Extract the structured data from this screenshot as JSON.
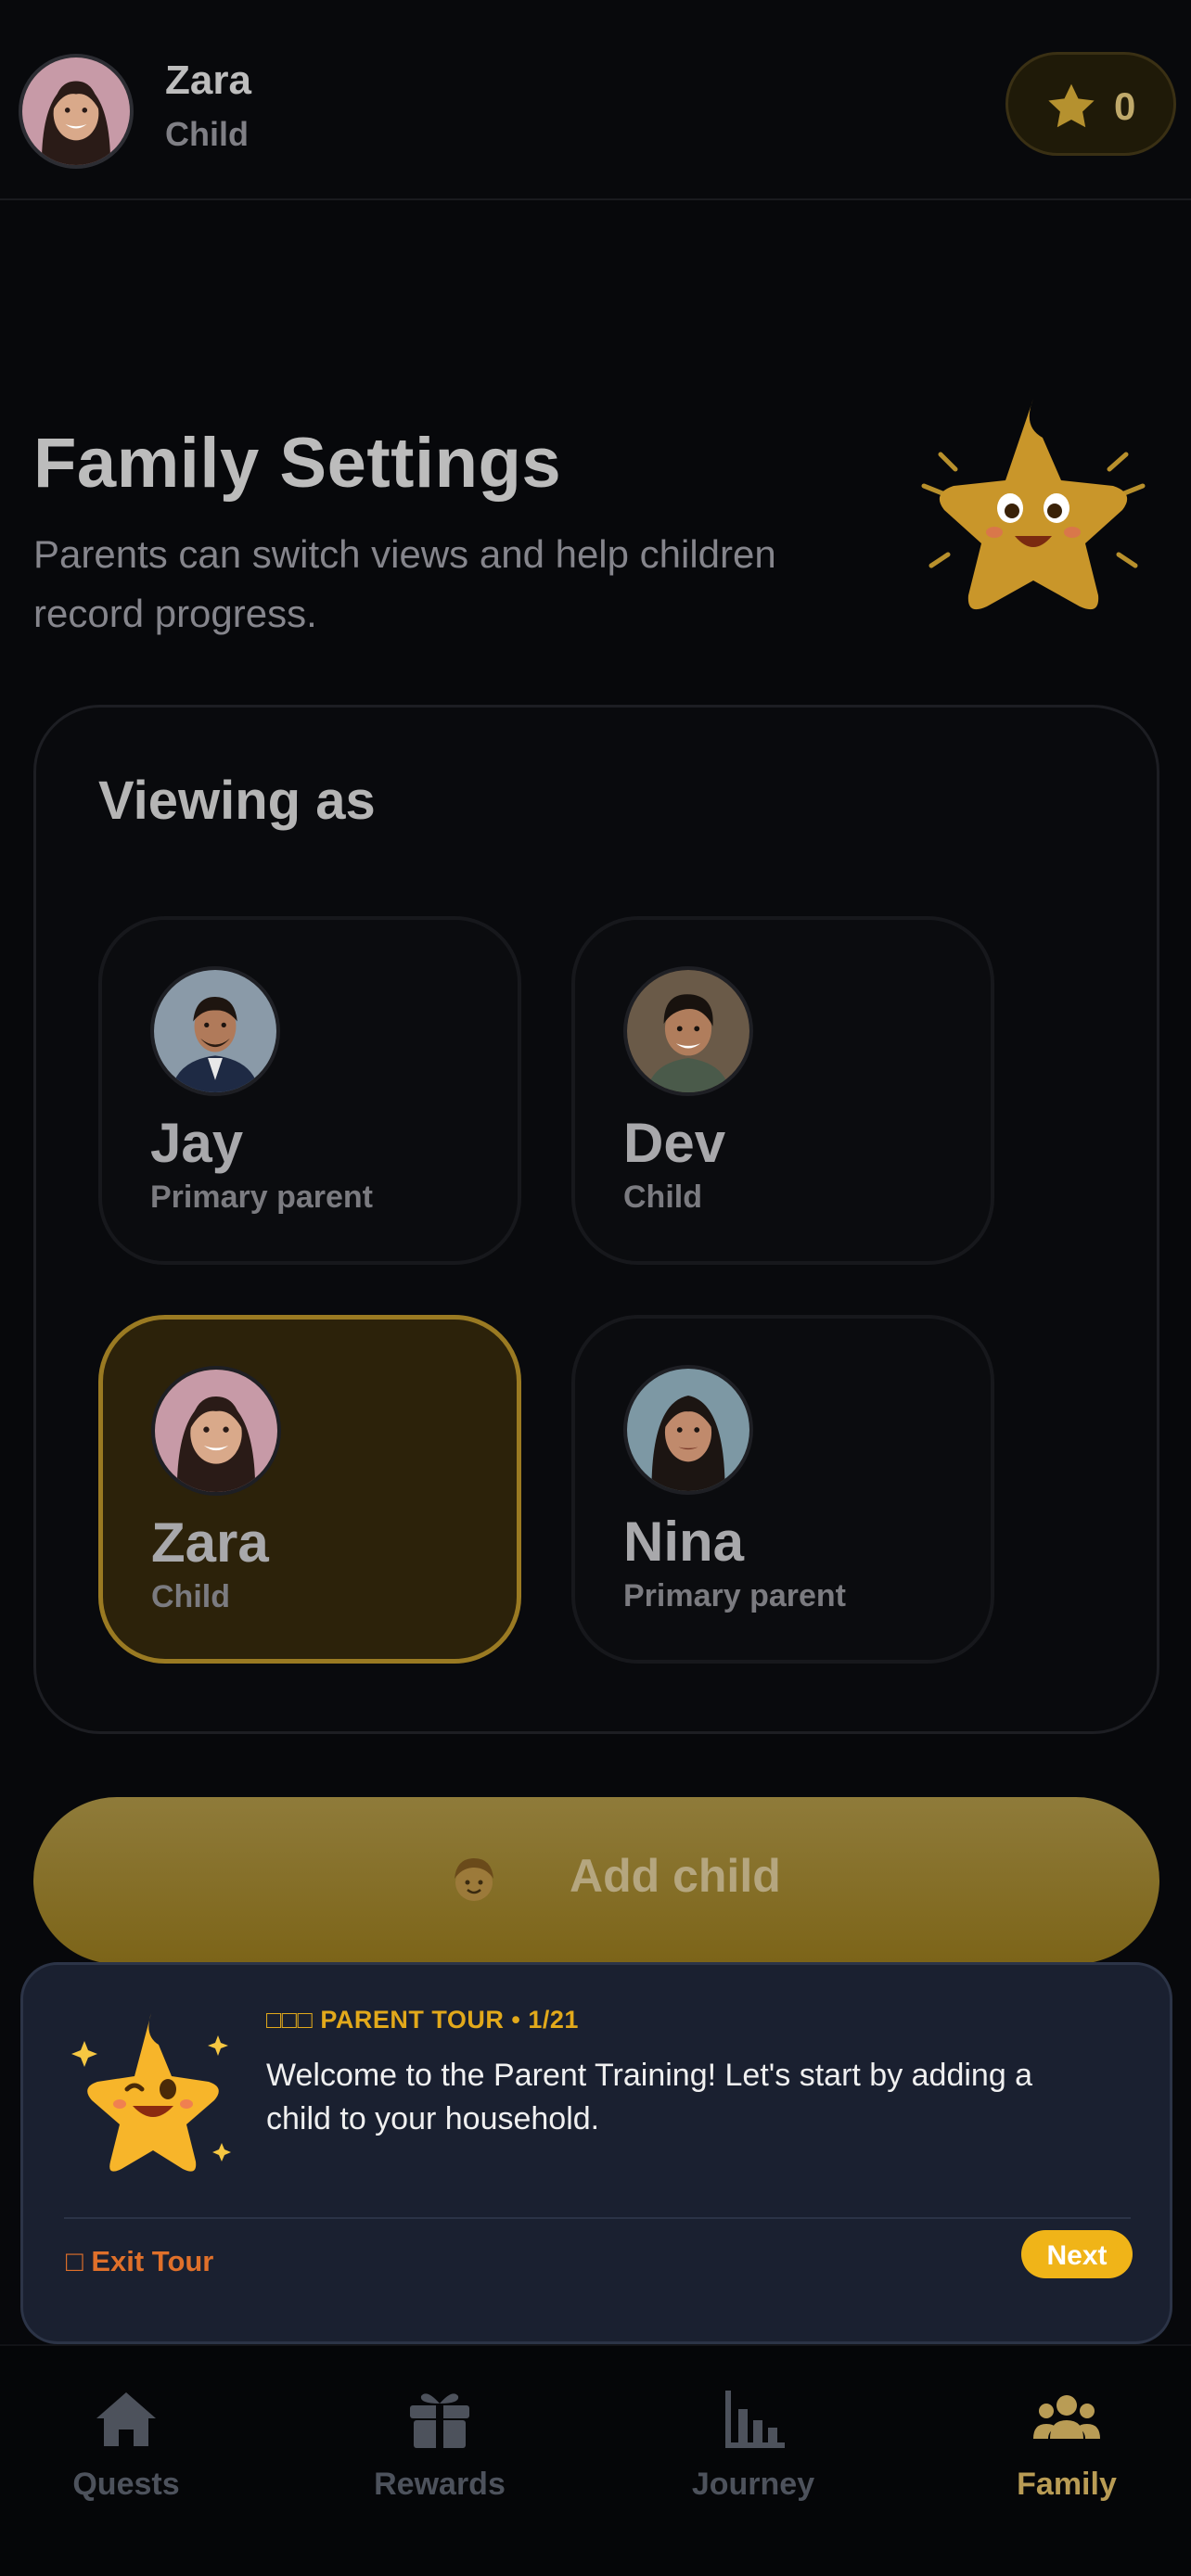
{
  "header": {
    "user_name": "Zara",
    "user_role": "Child",
    "stars": "0"
  },
  "page": {
    "title": "Family Settings",
    "subtitle": "Parents can switch views and help children record progress."
  },
  "viewing": {
    "title": "Viewing as",
    "members": [
      {
        "name": "Jay",
        "role": "Primary parent",
        "selected": false
      },
      {
        "name": "Dev",
        "role": "Child",
        "selected": false
      },
      {
        "name": "Zara",
        "role": "Child",
        "selected": true
      },
      {
        "name": "Nina",
        "role": "Primary parent",
        "selected": false
      }
    ]
  },
  "add_child": {
    "label": "Add child",
    "icon": "child-emoji-icon"
  },
  "tour": {
    "tag": "□□□ PARENT TOUR • 1/21",
    "message": "Welcome to the Parent Training! Let's start by adding a child to your household.",
    "exit_label": "□ Exit Tour",
    "next_label": "Next"
  },
  "tabs": [
    {
      "label": "Quests",
      "icon": "home-icon",
      "active": false
    },
    {
      "label": "Rewards",
      "icon": "gift-icon",
      "active": false
    },
    {
      "label": "Journey",
      "icon": "bar-chart-icon",
      "active": false
    },
    {
      "label": "Family",
      "icon": "users-icon",
      "active": true
    }
  ],
  "colors": {
    "accent": "#f0b418",
    "selected_border": "#9a7a22",
    "tour_background": "#1a2030",
    "exit": "#e0702a"
  }
}
